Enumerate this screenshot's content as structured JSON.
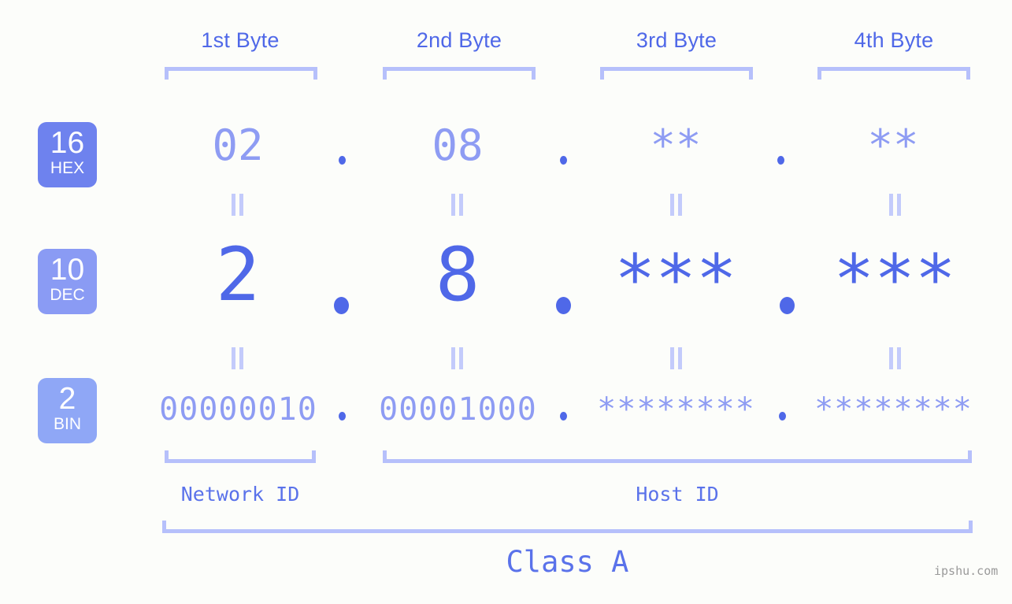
{
  "colors": {
    "background": "#fcfdfa",
    "accent_strong": "#4f68e8",
    "accent_mid": "#8e9cf3",
    "accent_light": "#b6c0fb",
    "badge_hex": "#6e82ee",
    "badge_dec": "#8a9bf4",
    "badge_bin": "#8fa7f6",
    "watermark": "#9a9a9a"
  },
  "byte_headers": [
    {
      "label": "1st Byte"
    },
    {
      "label": "2nd Byte"
    },
    {
      "label": "3rd Byte"
    },
    {
      "label": "4th Byte"
    }
  ],
  "bases": [
    {
      "number": "16",
      "name": "HEX"
    },
    {
      "number": "10",
      "name": "DEC"
    },
    {
      "number": "2",
      "name": "BIN"
    }
  ],
  "rows": {
    "hex": {
      "base_number": "16",
      "base_name": "HEX",
      "values": [
        "02",
        "08",
        "**",
        "**"
      ],
      "separators": [
        ".",
        ".",
        "."
      ]
    },
    "dec": {
      "base_number": "10",
      "base_name": "DEC",
      "values": [
        "2",
        "8",
        "***",
        "***"
      ],
      "separators": [
        ".",
        ".",
        "."
      ]
    },
    "bin": {
      "base_number": "2",
      "base_name": "BIN",
      "values": [
        "00000010",
        "00001000",
        "********",
        "********"
      ],
      "separators": [
        ".",
        ".",
        "."
      ]
    }
  },
  "id_sections": [
    {
      "label": "Network ID"
    },
    {
      "label": "Host ID"
    }
  ],
  "class_label": "Class A",
  "watermark": "ipshu.com",
  "equality_marks": {
    "glyph": "||",
    "count_per_gap": 4,
    "gaps": 2
  }
}
